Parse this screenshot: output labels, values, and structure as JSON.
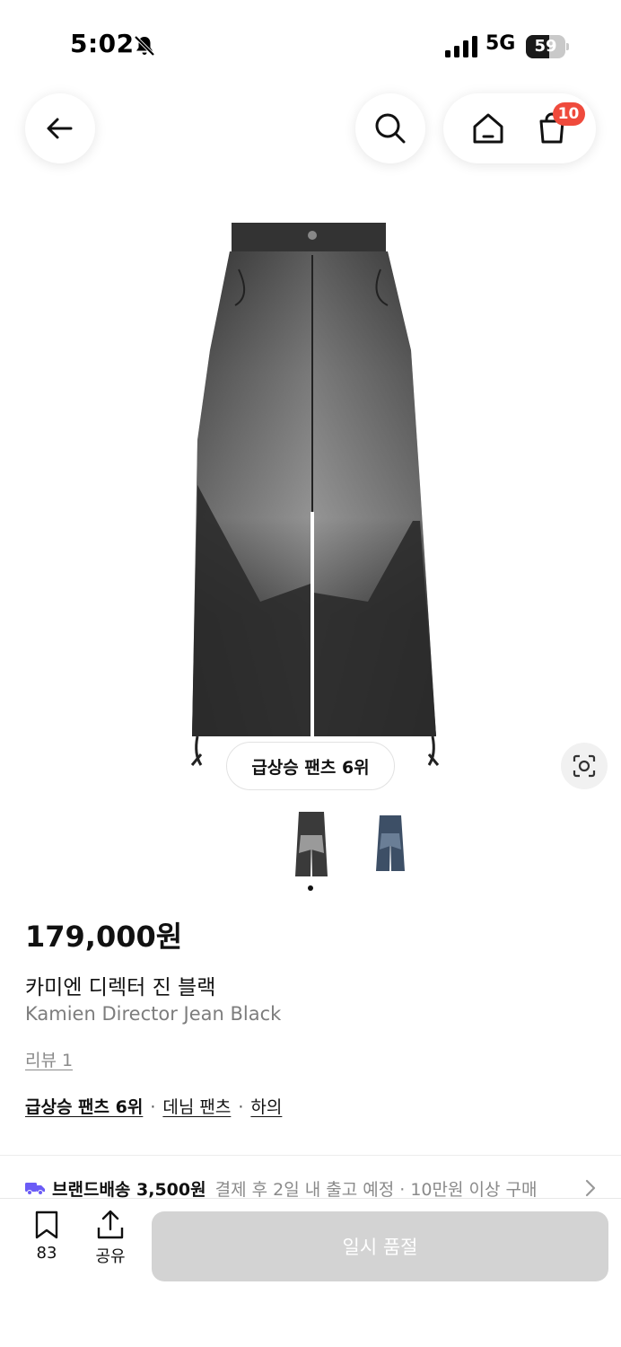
{
  "status_bar": {
    "time": "5:02",
    "network": "5G",
    "battery": "59",
    "battery_level": 0.59,
    "icons": [
      "bell-slash-icon",
      "signal-bars-icon",
      "battery-icon"
    ]
  },
  "nav": {
    "back_icon": "arrow-left-icon",
    "search_icon": "search-icon",
    "home_icon": "home-icon",
    "cart_icon": "cart-icon",
    "cart_count": "10",
    "badge_color": "#ef4a3c"
  },
  "product": {
    "trend_chip": "급상승 팬츠 6위",
    "image_count": 2,
    "selected_image": 1,
    "price": "179,000원",
    "name_ko": "카미엔 디렉터 진 블랙",
    "name_en": "Kamien Director Jean Black",
    "review_link": "리뷰 1",
    "ranking": "급상승 팬츠 6위",
    "sep": "·",
    "category_1": "데님 팬츠",
    "category_2": "하의"
  },
  "shipping": {
    "title": "브랜드배송 3,500원",
    "desc": "결제 후 2일 내 출고 예정 · 10만원 이상 구매",
    "icon": "truck-icon",
    "icon_color": "#6b5cf6"
  },
  "bottom_bar": {
    "bookmark_count": "83",
    "share_label": "공유",
    "soldout_label": "일시 품절"
  }
}
